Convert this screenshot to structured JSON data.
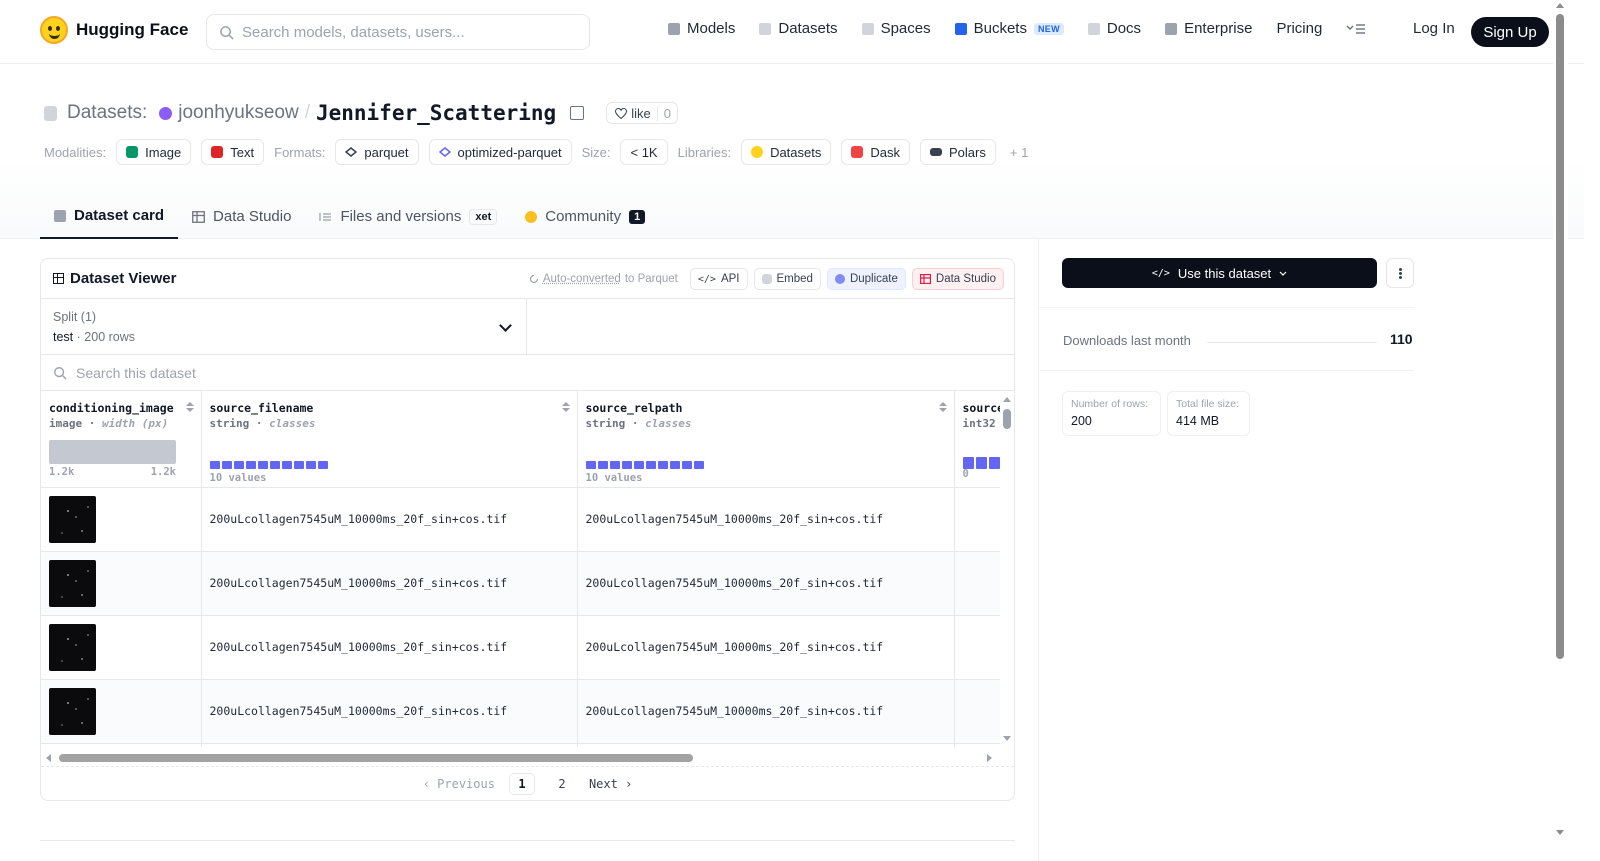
{
  "nav": {
    "brand": "Hugging Face",
    "search_placeholder": "Search models, datasets, users...",
    "links": [
      {
        "label": "Models",
        "icon": "models-icon",
        "color": "#9ca3af"
      },
      {
        "label": "Datasets",
        "icon": "datasets-icon",
        "color": "#d1d5db"
      },
      {
        "label": "Spaces",
        "icon": "spaces-icon",
        "color": "#d1d5db"
      },
      {
        "label": "Buckets",
        "icon": "buckets-icon",
        "color": "#2563eb",
        "badge": "NEW"
      },
      {
        "label": "Docs",
        "icon": "docs-icon",
        "color": "#d1d5db"
      },
      {
        "label": "Enterprise",
        "icon": "enterprise-icon",
        "color": "#9ca3af"
      },
      {
        "label": "Pricing"
      }
    ],
    "login": "Log In",
    "signup": "Sign Up"
  },
  "header": {
    "section_label": "Datasets:",
    "owner": "joonhyukseow",
    "separator": "/",
    "dataset_name": "Jennifer_Scattering",
    "like_label": "like",
    "like_count": "0",
    "modalities_label": "Modalities:",
    "modalities": [
      {
        "label": "Image",
        "color": "#059669"
      },
      {
        "label": "Text",
        "color": "#dc2626"
      }
    ],
    "formats_label": "Formats:",
    "formats": [
      "parquet",
      "optimized-parquet"
    ],
    "size_label": "Size:",
    "size_value": "< 1K",
    "libraries_label": "Libraries:",
    "libraries": [
      {
        "label": "Datasets",
        "color": "#ffd21e"
      },
      {
        "label": "Dask",
        "color": "#ef4444"
      },
      {
        "label": "Polars",
        "color": "#374151"
      }
    ],
    "libraries_more": "+ 1"
  },
  "tabs": [
    {
      "label": "Dataset card",
      "active": true
    },
    {
      "label": "Data Studio"
    },
    {
      "label": "Files and versions",
      "badge": "xet"
    },
    {
      "label": "Community",
      "count": "1"
    }
  ],
  "viewer": {
    "title": "Dataset Viewer",
    "auto_converted": "Auto-converted",
    "auto_converted_suffix": "to Parquet",
    "actions": {
      "api": "API",
      "embed": "Embed",
      "duplicate": "Duplicate",
      "data_studio": "Data Studio"
    },
    "split_label": "Split (1)",
    "split_name": "test",
    "split_dot": "·",
    "split_rows": "200 rows",
    "search_placeholder": "Search this dataset",
    "columns": [
      {
        "name": "conditioning_image",
        "type": "image",
        "sub": "width (px)",
        "stat_min": "1.2k",
        "stat_max": "1.2k"
      },
      {
        "name": "source_filename",
        "type": "string",
        "sub": "classes",
        "stat": "10 values"
      },
      {
        "name": "source_relpath",
        "type": "string",
        "sub": "classes",
        "stat": "10 values"
      },
      {
        "name": "source_",
        "type": "int32",
        "sub": "",
        "stat": "0"
      }
    ],
    "rows": [
      {
        "filename": "200uLcollagen7545uM_10000ms_20f_sin+cos.tif",
        "relpath": "200uLcollagen7545uM_10000ms_20f_sin+cos.tif"
      },
      {
        "filename": "200uLcollagen7545uM_10000ms_20f_sin+cos.tif",
        "relpath": "200uLcollagen7545uM_10000ms_20f_sin+cos.tif"
      },
      {
        "filename": "200uLcollagen7545uM_10000ms_20f_sin+cos.tif",
        "relpath": "200uLcollagen7545uM_10000ms_20f_sin+cos.tif"
      },
      {
        "filename": "200uLcollagen7545uM_10000ms_20f_sin+cos.tif",
        "relpath": "200uLcollagen7545uM_10000ms_20f_sin+cos.tif"
      }
    ],
    "pager": {
      "prev": "Previous",
      "pages": [
        "1",
        "2"
      ],
      "current": "1",
      "next": "Next"
    }
  },
  "sidebar": {
    "use_button": "Use this dataset",
    "downloads_label": "Downloads last month",
    "downloads_value": "110",
    "stats": [
      {
        "label": "Number of rows:",
        "value": "200"
      },
      {
        "label": "Total file size:",
        "value": "414 MB"
      }
    ]
  }
}
